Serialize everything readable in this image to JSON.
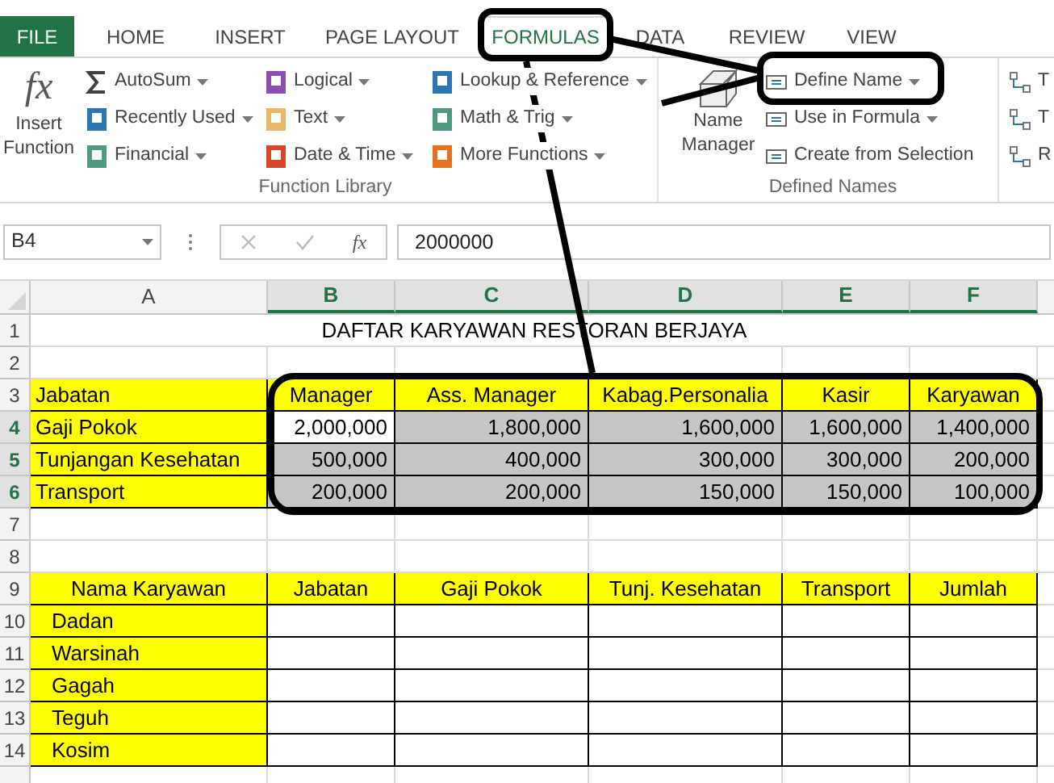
{
  "ribbon": {
    "tabs": [
      {
        "label": "FILE",
        "kind": "file",
        "selected": false
      },
      {
        "label": "HOME",
        "kind": "tab",
        "selected": false
      },
      {
        "label": "INSERT",
        "kind": "tab",
        "selected": false
      },
      {
        "label": "PAGE LAYOUT",
        "kind": "tab",
        "selected": false
      },
      {
        "label": "FORMULAS",
        "kind": "tab",
        "selected": true
      },
      {
        "label": "DATA",
        "kind": "tab",
        "selected": false
      },
      {
        "label": "REVIEW",
        "kind": "tab",
        "selected": false
      },
      {
        "label": "VIEW",
        "kind": "tab",
        "selected": false
      }
    ],
    "function_library": {
      "label": "Function Library",
      "insert_function": "Insert Function",
      "insert_function_icon": "fx",
      "columns": [
        [
          {
            "label": "AutoSum",
            "color": "#404040",
            "dropdown": true
          },
          {
            "label": "Recently Used",
            "color": "#2e75b6",
            "dropdown": true
          },
          {
            "label": "Financial",
            "color": "#4f9a7d",
            "dropdown": true
          }
        ],
        [
          {
            "label": "Logical",
            "color": "#8b4fb0",
            "dropdown": true
          },
          {
            "label": "Text",
            "color": "#e8b86a",
            "dropdown": true
          },
          {
            "label": "Date & Time",
            "color": "#d9472b",
            "dropdown": true
          }
        ],
        [
          {
            "label": "Lookup & Reference",
            "color": "#2e75b6",
            "dropdown": true
          },
          {
            "label": "Math & Trig",
            "color": "#4f9a7d",
            "dropdown": true
          },
          {
            "label": "More Functions",
            "color": "#e8721c",
            "dropdown": true
          }
        ]
      ]
    },
    "defined_names": {
      "label": "Defined Names",
      "name_manager": "Name Manager",
      "items": [
        {
          "label": "Define Name",
          "dropdown": true
        },
        {
          "label": "Use in Formula",
          "dropdown": true
        },
        {
          "label": "Create from Selection",
          "dropdown": false
        }
      ]
    },
    "formula_auditing": {
      "items": [
        {
          "label": "T"
        },
        {
          "label": "T"
        },
        {
          "label": "R"
        }
      ]
    }
  },
  "formula_bar": {
    "name_box": "B4",
    "function_icon": "fx",
    "value": "2000000"
  },
  "sheet": {
    "columns": [
      {
        "label": "A",
        "selected": false
      },
      {
        "label": "B",
        "selected": true
      },
      {
        "label": "C",
        "selected": true
      },
      {
        "label": "D",
        "selected": true
      },
      {
        "label": "E",
        "selected": true
      },
      {
        "label": "F",
        "selected": true
      }
    ],
    "rows": [
      {
        "number": "1",
        "selected": false,
        "title": "DAFTAR KARYAWAN RESTORAN BERJAYA"
      },
      {
        "number": "2",
        "selected": false,
        "cells": []
      },
      {
        "number": "3",
        "selected": false,
        "cells": [
          {
            "text": "Jabatan",
            "kind": "label",
            "highlighted": true,
            "bordered": true
          },
          {
            "text": "Manager",
            "kind": "header",
            "highlighted": true,
            "bordered": true
          },
          {
            "text": "Ass. Manager",
            "kind": "header",
            "highlighted": true,
            "bordered": true
          },
          {
            "text": "Kabag.Personalia",
            "kind": "header",
            "highlighted": true,
            "bordered": true
          },
          {
            "text": "Kasir",
            "kind": "header",
            "highlighted": true,
            "bordered": true
          },
          {
            "text": "Karyawan",
            "kind": "header",
            "highlighted": true,
            "bordered": true
          }
        ]
      },
      {
        "number": "4",
        "selected": true,
        "cells": [
          {
            "text": "Gaji Pokok",
            "kind": "label",
            "highlighted": true,
            "bordered": true
          },
          {
            "text": "2,000,000",
            "kind": "number",
            "highlighted": false,
            "bordered": true,
            "active": true
          },
          {
            "text": "1,800,000",
            "kind": "number",
            "highlighted": false,
            "bordered": true
          },
          {
            "text": "1,600,000",
            "kind": "number",
            "highlighted": false,
            "bordered": true
          },
          {
            "text": "1,600,000",
            "kind": "number",
            "highlighted": false,
            "bordered": true
          },
          {
            "text": "1,400,000",
            "kind": "number",
            "highlighted": false,
            "bordered": true
          }
        ]
      },
      {
        "number": "5",
        "selected": true,
        "cells": [
          {
            "text": "Tunjangan Kesehatan",
            "kind": "label",
            "highlighted": true,
            "bordered": true
          },
          {
            "text": "500,000",
            "kind": "number",
            "highlighted": false,
            "bordered": true
          },
          {
            "text": "400,000",
            "kind": "number",
            "highlighted": false,
            "bordered": true
          },
          {
            "text": "300,000",
            "kind": "number",
            "highlighted": false,
            "bordered": true
          },
          {
            "text": "300,000",
            "kind": "number",
            "highlighted": false,
            "bordered": true
          },
          {
            "text": "200,000",
            "kind": "number",
            "highlighted": false,
            "bordered": true
          }
        ]
      },
      {
        "number": "6",
        "selected": true,
        "cells": [
          {
            "text": "Transport",
            "kind": "label",
            "highlighted": true,
            "bordered": true
          },
          {
            "text": "200,000",
            "kind": "number",
            "highlighted": false,
            "bordered": true
          },
          {
            "text": "200,000",
            "kind": "number",
            "highlighted": false,
            "bordered": true
          },
          {
            "text": "150,000",
            "kind": "number",
            "highlighted": false,
            "bordered": true
          },
          {
            "text": "150,000",
            "kind": "number",
            "highlighted": false,
            "bordered": true
          },
          {
            "text": "100,000",
            "kind": "number",
            "highlighted": false,
            "bordered": true
          }
        ]
      },
      {
        "number": "7",
        "selected": false,
        "cells": []
      },
      {
        "number": "8",
        "selected": false,
        "cells": []
      },
      {
        "number": "9",
        "selected": false,
        "cells": [
          {
            "text": "Nama Karyawan",
            "kind": "header",
            "highlighted": true,
            "bordered": true
          },
          {
            "text": "Jabatan",
            "kind": "header",
            "highlighted": true,
            "bordered": true
          },
          {
            "text": "Gaji Pokok",
            "kind": "header",
            "highlighted": true,
            "bordered": true
          },
          {
            "text": "Tunj. Kesehatan",
            "kind": "header",
            "highlighted": true,
            "bordered": true
          },
          {
            "text": "Transport",
            "kind": "header",
            "highlighted": true,
            "bordered": true
          },
          {
            "text": "Jumlah",
            "kind": "header",
            "highlighted": true,
            "bordered": true
          }
        ]
      },
      {
        "number": "10",
        "selected": false,
        "cells": [
          {
            "text": "Dadan",
            "kind": "name",
            "highlighted": true,
            "bordered": true
          },
          {
            "kind": "empty",
            "highlighted": false,
            "bordered": true
          },
          {
            "kind": "empty",
            "highlighted": false,
            "bordered": true
          },
          {
            "kind": "empty",
            "highlighted": false,
            "bordered": true
          },
          {
            "kind": "empty",
            "highlighted": false,
            "bordered": true
          },
          {
            "kind": "empty",
            "highlighted": false,
            "bordered": true
          }
        ]
      },
      {
        "number": "11",
        "selected": false,
        "cells": [
          {
            "text": "Warsinah",
            "kind": "name",
            "highlighted": true,
            "bordered": true
          },
          {
            "kind": "empty",
            "highlighted": false,
            "bordered": true
          },
          {
            "kind": "empty",
            "highlighted": false,
            "bordered": true
          },
          {
            "kind": "empty",
            "highlighted": false,
            "bordered": true
          },
          {
            "kind": "empty",
            "highlighted": false,
            "bordered": true
          },
          {
            "kind": "empty",
            "highlighted": false,
            "bordered": true
          }
        ]
      },
      {
        "number": "12",
        "selected": false,
        "cells": [
          {
            "text": "Gagah",
            "kind": "name",
            "highlighted": true,
            "bordered": true
          },
          {
            "kind": "empty",
            "highlighted": false,
            "bordered": true
          },
          {
            "kind": "empty",
            "highlighted": false,
            "bordered": true
          },
          {
            "kind": "empty",
            "highlighted": false,
            "bordered": true
          },
          {
            "kind": "empty",
            "highlighted": false,
            "bordered": true
          },
          {
            "kind": "empty",
            "highlighted": false,
            "bordered": true
          }
        ]
      },
      {
        "number": "13",
        "selected": false,
        "cells": [
          {
            "text": "Teguh",
            "kind": "name",
            "highlighted": true,
            "bordered": true
          },
          {
            "kind": "empty",
            "highlighted": false,
            "bordered": true
          },
          {
            "kind": "empty",
            "highlighted": false,
            "bordered": true
          },
          {
            "kind": "empty",
            "highlighted": false,
            "bordered": true
          },
          {
            "kind": "empty",
            "highlighted": false,
            "bordered": true
          },
          {
            "kind": "empty",
            "highlighted": false,
            "bordered": true
          }
        ]
      },
      {
        "number": "14",
        "selected": false,
        "cells": [
          {
            "text": "Kosim",
            "kind": "name",
            "highlighted": true,
            "bordered": true
          },
          {
            "kind": "empty",
            "highlighted": false,
            "bordered": true
          },
          {
            "kind": "empty",
            "highlighted": false,
            "bordered": true
          },
          {
            "kind": "empty",
            "highlighted": false,
            "bordered": true
          },
          {
            "kind": "empty",
            "highlighted": false,
            "bordered": true
          },
          {
            "kind": "empty",
            "highlighted": false,
            "bordered": true
          }
        ]
      },
      {
        "selected": false,
        "cells": []
      }
    ]
  }
}
